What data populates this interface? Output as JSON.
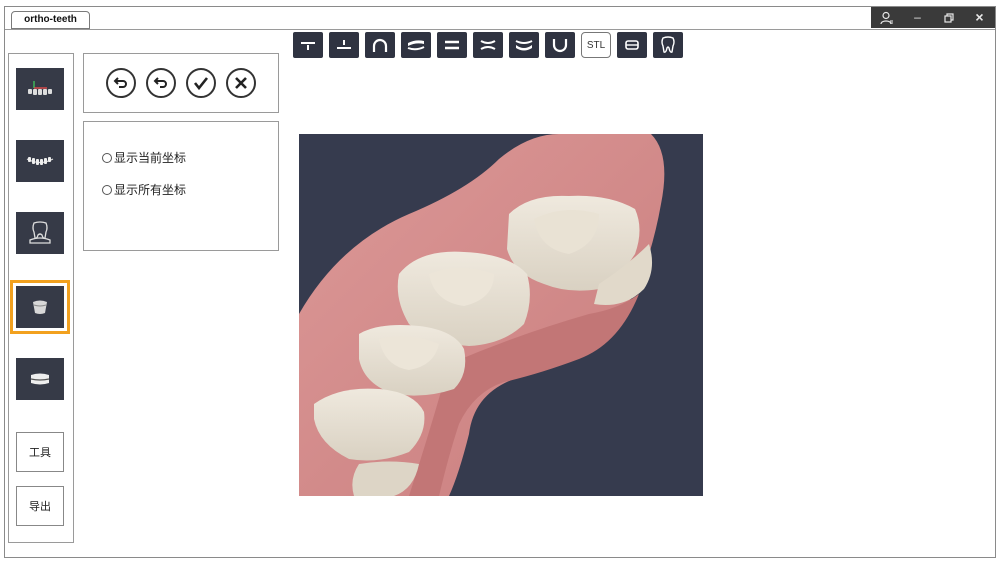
{
  "window": {
    "title": "ortho-teeth"
  },
  "window_controls": [
    {
      "name": "user-icon",
      "label": ""
    },
    {
      "name": "minimize",
      "label": "–"
    },
    {
      "name": "restore",
      "label": ""
    },
    {
      "name": "close",
      "label": "×"
    }
  ],
  "toolbar": {
    "stl_label": "STL",
    "icons": [
      "split-top-icon",
      "split-bottom-icon",
      "arch-icon",
      "curve-icon",
      "parallel-icon",
      "merge-icon",
      "smile-icon",
      "cup-icon",
      "stl",
      "tray-icon",
      "tooth-icon"
    ]
  },
  "sidebar": {
    "items": [
      {
        "icon": "axis-teeth-icon"
      },
      {
        "icon": "full-arch-icon"
      },
      {
        "icon": "tooth-gum-icon"
      },
      {
        "icon": "crown-icon",
        "active": true
      },
      {
        "icon": "tray-icon"
      }
    ],
    "tools_label": "工具",
    "export_label": "导出"
  },
  "actions": {
    "undo": "undo-icon",
    "redo": "redo-icon",
    "confirm": "check-icon",
    "cancel": "x-icon"
  },
  "options": {
    "show_current": "显示当前坐标",
    "show_all": "显示所有坐标"
  },
  "colors": {
    "dark_button": "#2f3341",
    "active_outline": "#f2a11f",
    "viewport_bg": "#363b4e",
    "gum": "#d68a8a",
    "tooth": "#e8e2d6"
  }
}
